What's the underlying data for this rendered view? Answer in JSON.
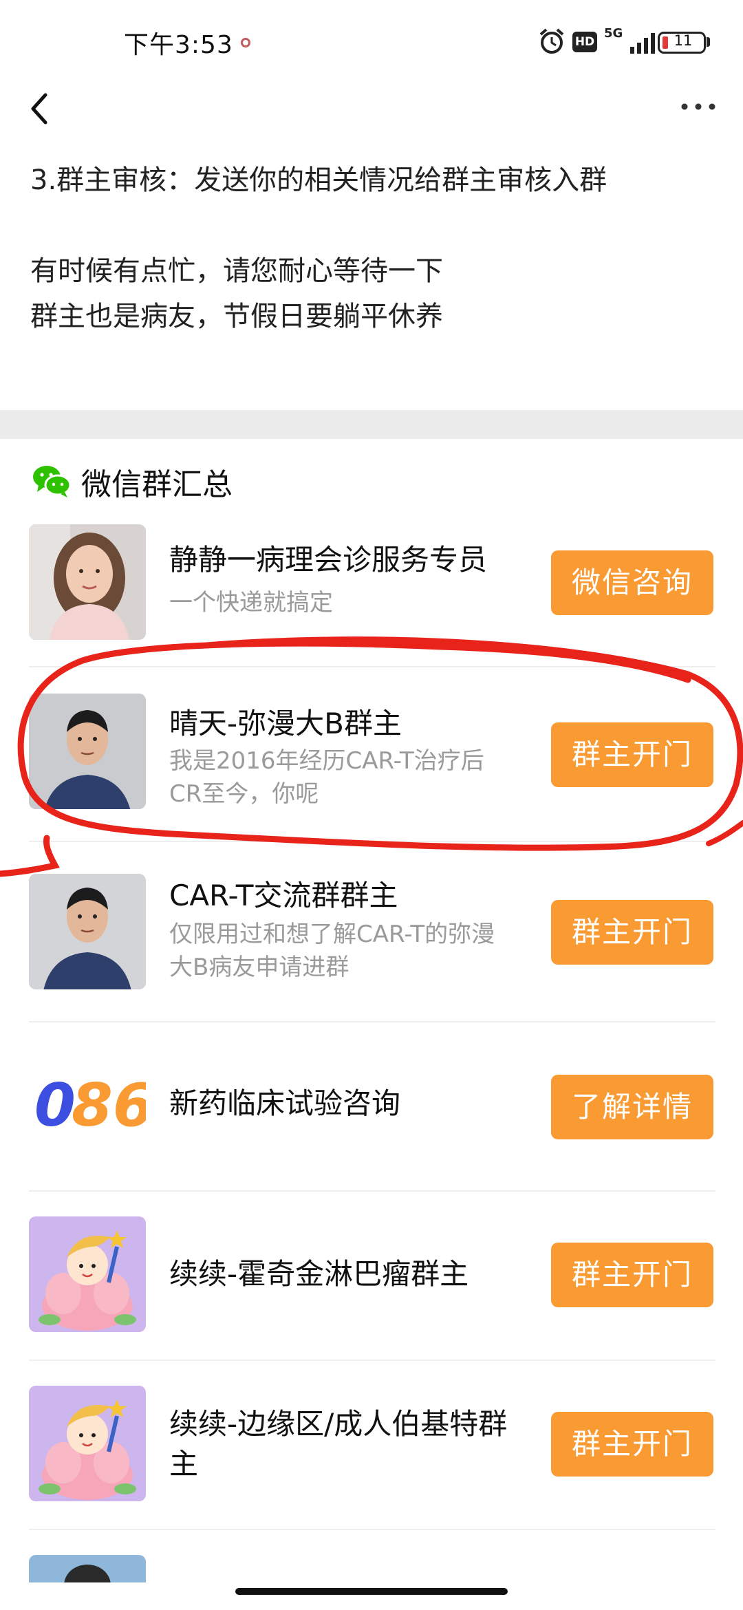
{
  "status_bar": {
    "time": "下午3:53",
    "hd": "HD",
    "network": "5G",
    "battery": "11",
    "battery_color": "#e43a3a"
  },
  "nav": {
    "back_icon": "back-arrow-icon",
    "more_icon": "more-dots-icon"
  },
  "notice": {
    "line1": "3.群主审核：发送你的相关情况给群主审核入群",
    "line2": "有时候有点忙，请您耐心等待一下",
    "line3": "群主也是病友，节假日要躺平休养"
  },
  "section": {
    "title": "微信群汇总",
    "icon": "wechat-icon",
    "accent": "#2dc100"
  },
  "rows": [
    {
      "title": "静静一病理会诊服务专员",
      "subtitle": "一个快递就搞定",
      "button": "微信咨询"
    },
    {
      "title": "晴天-弥漫大B群主",
      "subtitle_line1": "我是2016年经历CAR-T治疗后",
      "subtitle_line2": "CR至今，你呢",
      "button": "群主开门"
    },
    {
      "title": "CAR-T交流群群主",
      "subtitle_line1": "仅限用过和想了解CAR-T的弥漫",
      "subtitle_line2": "大B病友申请进群",
      "button": "群主开门"
    },
    {
      "title": "新药临床试验咨询",
      "logo_text": "086",
      "button": "了解详情"
    },
    {
      "title": "续续-霍奇金淋巴瘤群主",
      "button": "群主开门"
    },
    {
      "title_line1": "续续-边缘区/成人伯基特群",
      "title_line2": "主",
      "button": "群主开门"
    }
  ],
  "colors": {
    "button_bg": "#f99a32",
    "annotation": "#e8231a"
  }
}
